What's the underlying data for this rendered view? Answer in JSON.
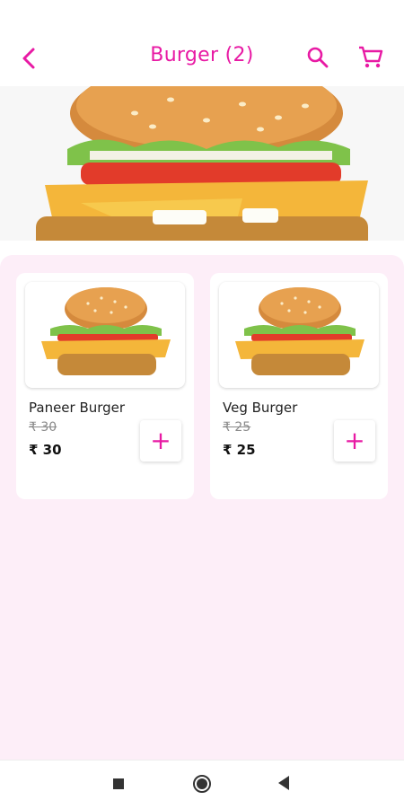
{
  "header": {
    "title": "Burger (2)",
    "back_icon": "chevron-left-icon",
    "search_icon": "search-icon",
    "cart_icon": "cart-icon",
    "accent_color": "#e81aa4"
  },
  "banner": {
    "image": "burger-banner-image"
  },
  "products": [
    {
      "name": "Paneer Burger",
      "mrp": "₹ 30",
      "price": "₹ 30",
      "add_label": "+"
    },
    {
      "name": "Veg Burger",
      "mrp": "₹ 25",
      "price": "₹ 25",
      "add_label": "+"
    }
  ],
  "navbar": {
    "recents_icon": "square-icon",
    "home_icon": "circle-home-icon",
    "back_icon": "triangle-back-icon"
  }
}
